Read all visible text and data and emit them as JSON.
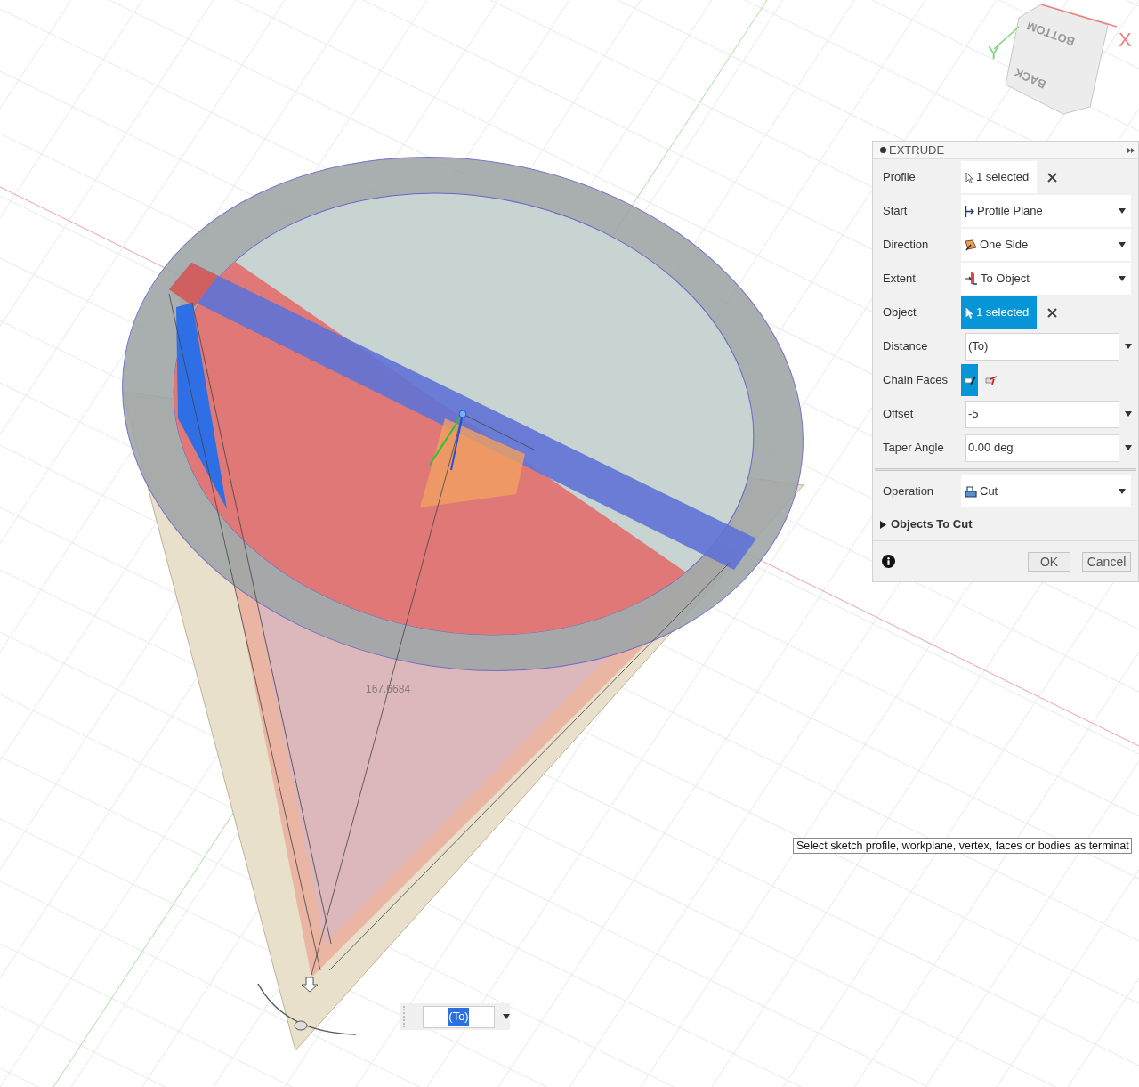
{
  "viewcube": {
    "faces": [
      "BOTTOM",
      "BACK"
    ],
    "axes": [
      "X",
      "Y"
    ]
  },
  "dimension_label": "167.6684",
  "panel": {
    "title": "EXTRUDE",
    "rows": [
      {
        "kind": "selection",
        "label": "Profile",
        "value": "1 selected",
        "selected": false
      },
      {
        "kind": "dropdown",
        "label": "Start",
        "value": "Profile Plane"
      },
      {
        "kind": "dropdown",
        "label": "Direction",
        "value": "One Side"
      },
      {
        "kind": "dropdown",
        "label": "Extent",
        "value": "To Object"
      },
      {
        "kind": "selection",
        "label": "Object",
        "value": "1 selected",
        "selected": true
      },
      {
        "kind": "input",
        "label": "Distance",
        "value": "(To)"
      },
      {
        "kind": "toggles",
        "label": "Chain Faces",
        "options": [
          {
            "selected": true
          },
          {
            "selected": false
          }
        ]
      },
      {
        "kind": "input",
        "label": "Offset",
        "value": "-5"
      },
      {
        "kind": "input",
        "label": "Taper Angle",
        "value": "0.00 deg"
      },
      {
        "kind": "divider"
      },
      {
        "kind": "dropdown",
        "label": "Operation",
        "value": "Cut"
      }
    ],
    "section": {
      "label": "Objects To Cut",
      "expanded": false
    },
    "buttons": [
      "OK",
      "Cancel"
    ]
  },
  "tooltip": "Select sketch profile, workplane, vertex, faces or bodies as terminat",
  "distance_input": {
    "value": "(To)"
  }
}
